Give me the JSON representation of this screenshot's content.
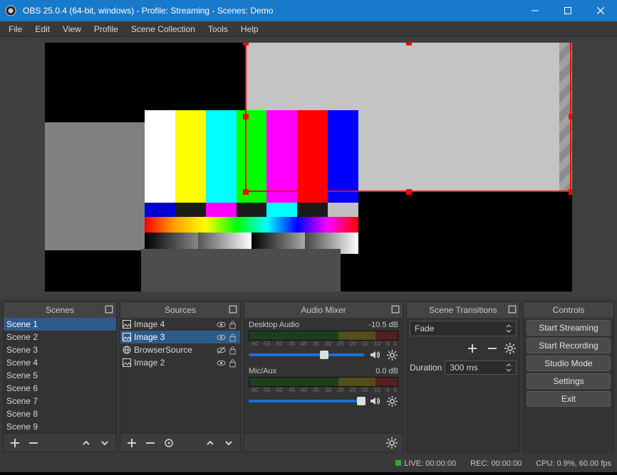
{
  "window": {
    "title": "OBS 25.0.4 (64-bit, windows) - Profile: Streaming - Scenes: Demo"
  },
  "menu": [
    "File",
    "Edit",
    "View",
    "Profile",
    "Scene Collection",
    "Tools",
    "Help"
  ],
  "scenes": {
    "title": "Scenes",
    "items": [
      "Scene 1",
      "Scene 2",
      "Scene 3",
      "Scene 4",
      "Scene 5",
      "Scene 6",
      "Scene 7",
      "Scene 8",
      "Scene 9"
    ],
    "selected_index": 0
  },
  "sources": {
    "title": "Sources",
    "items": [
      {
        "name": "Image 4",
        "icon": "image",
        "visible": true,
        "locked": false
      },
      {
        "name": "Image 3",
        "icon": "image",
        "visible": true,
        "locked": false
      },
      {
        "name": "BrowserSource",
        "icon": "globe",
        "visible": false,
        "locked": false
      },
      {
        "name": "Image 2",
        "icon": "image",
        "visible": true,
        "locked": false
      }
    ],
    "selected_index": 1
  },
  "mixer": {
    "title": "Audio Mixer",
    "ticks": [
      "-60",
      "-55",
      "-50",
      "-45",
      "-40",
      "-35",
      "-30",
      "-25",
      "-20",
      "-15",
      "-10",
      "-5",
      "0"
    ],
    "channels": [
      {
        "name": "Desktop Audio",
        "level_db": "-10.5 dB",
        "slider_pct": 62
      },
      {
        "name": "Mic/Aux",
        "level_db": "0.0 dB",
        "slider_pct": 94
      }
    ]
  },
  "transitions": {
    "title": "Scene Transitions",
    "current": "Fade",
    "duration_label": "Duration",
    "duration_value": "300 ms"
  },
  "controls": {
    "title": "Controls",
    "buttons": [
      "Start Streaming",
      "Start Recording",
      "Studio Mode",
      "Settings",
      "Exit"
    ]
  },
  "status": {
    "live": "LIVE: 00:00:00",
    "rec": "REC: 00:00:00",
    "cpu": "CPU: 0.9%, 60.00 fps"
  }
}
